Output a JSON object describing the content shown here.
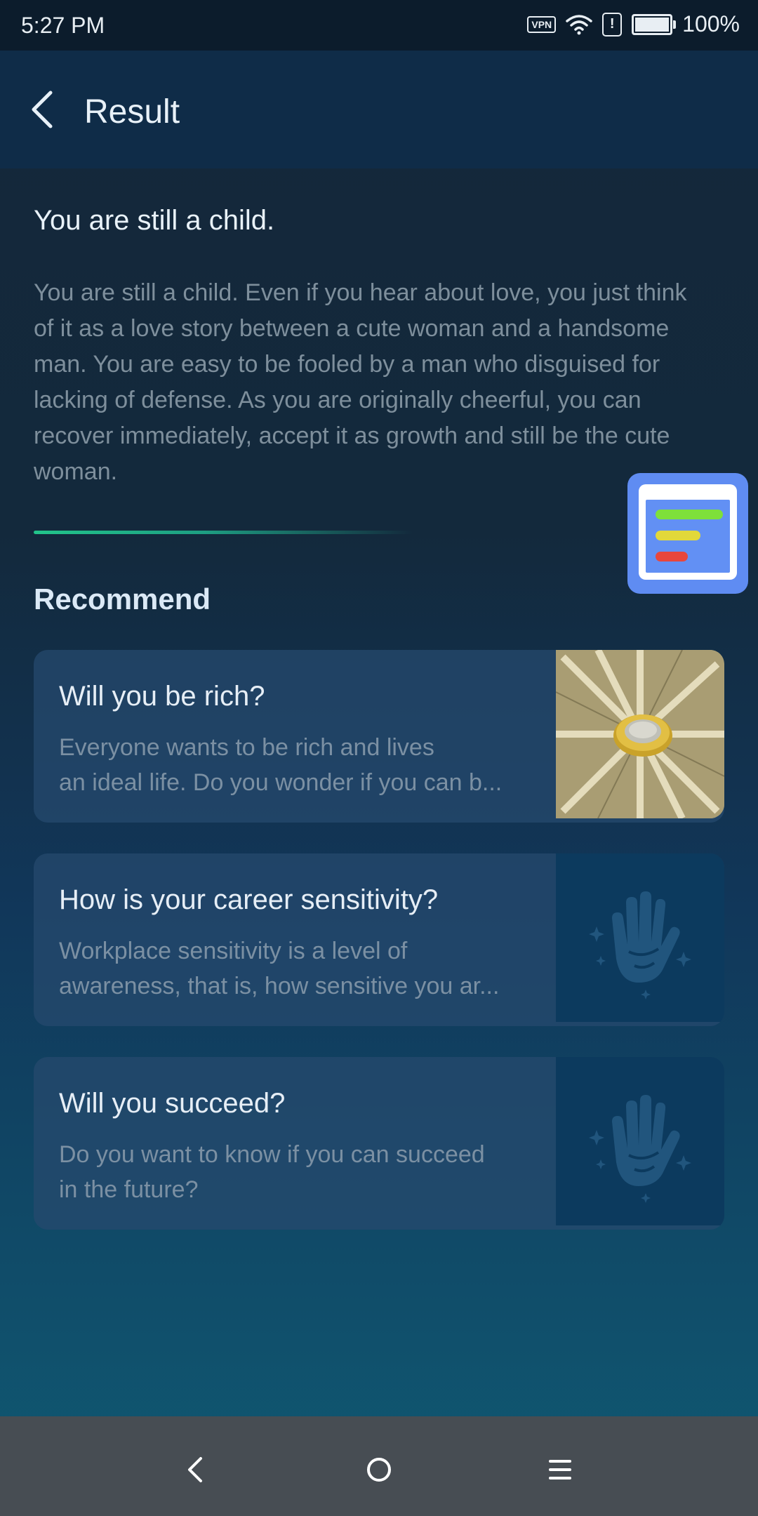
{
  "status_bar": {
    "time": "5:27 PM",
    "vpn_label": "VPN",
    "alert_label": "!",
    "battery": "100%",
    "icons": [
      "vpn-icon",
      "wifi-icon",
      "alert-icon",
      "battery-icon"
    ]
  },
  "app_bar": {
    "title": "Result",
    "back_icon": "chevron-left-icon"
  },
  "result": {
    "heading": "You are still a child.",
    "body": "You are still a child. Even if you hear about love, you just think of it as a love story between a cute woman and a handsome man. You are easy to be fooled by a man who disguised for lacking of defense. As you are originally cheerful, you can recover immediately, accept it as growth and still be the cute woman."
  },
  "floating_widget": {
    "icon": "checklist-icon",
    "bar_colors": [
      "#7ee03a",
      "#e2d83a",
      "#e8463c"
    ]
  },
  "recommend": {
    "heading": "Recommend",
    "items": [
      {
        "title": "Will you be rich?",
        "desc_line1": "Everyone wants to be rich and lives",
        "desc_line2": "an ideal life. Do you wonder if you can b...",
        "thumbnail": "money-coin-image"
      },
      {
        "title": "How is your career sensitivity?",
        "desc_line1": "Workplace sensitivity is a level of",
        "desc_line2": "awareness, that is, how sensitive you ar...",
        "thumbnail": "palm-hand-icon"
      },
      {
        "title": "Will you succeed?",
        "desc_line1": "Do you want to know if you can succeed",
        "desc_line2": "in the future?",
        "thumbnail": "palm-hand-icon"
      }
    ]
  },
  "nav_bar": {
    "items": [
      "back-triangle-icon",
      "home-circle-icon",
      "menu-lines-icon"
    ]
  },
  "colors": {
    "accent_green": "#22c48a",
    "app_bar_bg": "#0f2c48",
    "nav_bar_bg": "#474d53"
  }
}
